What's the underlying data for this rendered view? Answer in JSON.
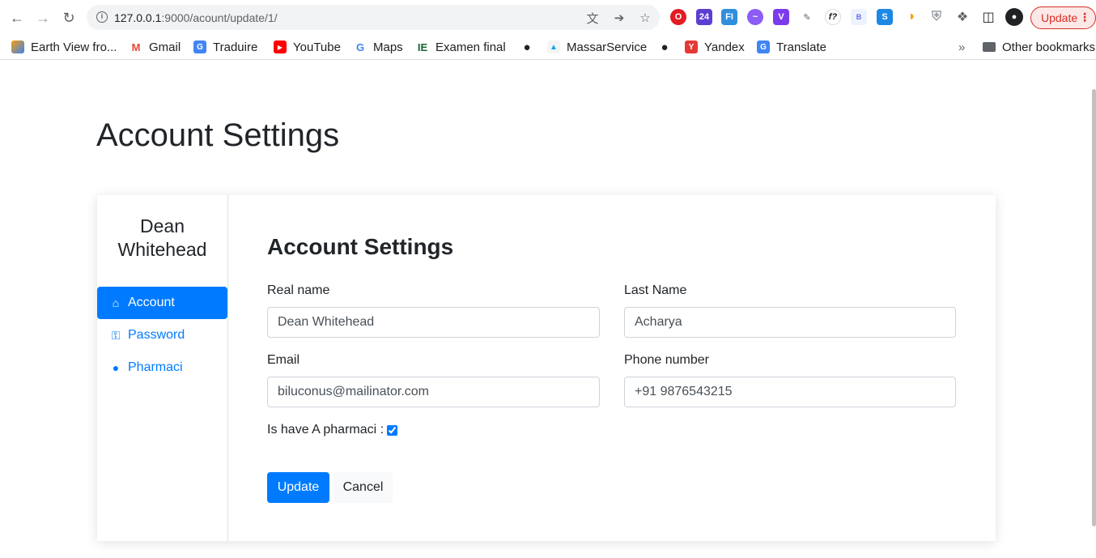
{
  "browser": {
    "url_host": "127.0.0.1",
    "url_rest": ":9000/acount/update/1/",
    "update_label": "Update",
    "bookmarks": [
      {
        "label": "Earth View fro...",
        "icon": "earth-view-icon"
      },
      {
        "label": "Gmail",
        "icon": "gmail-icon"
      },
      {
        "label": "Traduire",
        "icon": "translate-icon"
      },
      {
        "label": "YouTube",
        "icon": "youtube-icon"
      },
      {
        "label": "Maps",
        "icon": "google-icon"
      },
      {
        "label": "Examen final",
        "icon": "ie-icon"
      },
      {
        "label": "",
        "icon": "globe-icon"
      },
      {
        "label": "MassarService",
        "icon": "massar-icon"
      },
      {
        "label": "",
        "icon": "globe-icon"
      },
      {
        "label": "Yandex",
        "icon": "yandex-icon"
      },
      {
        "label": "Translate",
        "icon": "translate-icon"
      }
    ],
    "other_bookmarks": "Other bookmarks"
  },
  "page": {
    "title": "Account Settings"
  },
  "sidebar": {
    "user_name_line1": "Dean",
    "user_name_line2": "Whitehead",
    "items": [
      {
        "label": "Account",
        "icon": "home-icon",
        "active": true
      },
      {
        "label": "Password",
        "icon": "key-icon",
        "active": false
      },
      {
        "label": "Pharmaci",
        "icon": "user-icon",
        "active": false
      }
    ]
  },
  "form": {
    "section_title": "Account Settings",
    "real_name_label": "Real name",
    "real_name_value": "Dean Whitehead",
    "last_name_label": "Last Name",
    "last_name_value": "Acharya",
    "email_label": "Email",
    "email_value": "biluconus@mailinator.com",
    "phone_label": "Phone number",
    "phone_value": "+91 9876543215",
    "pharmaci_label": "Is have A pharmaci :",
    "pharmaci_checked": true,
    "update_button": "Update",
    "cancel_button": "Cancel"
  },
  "colors": {
    "primary": "#007bff",
    "text": "#212529"
  }
}
